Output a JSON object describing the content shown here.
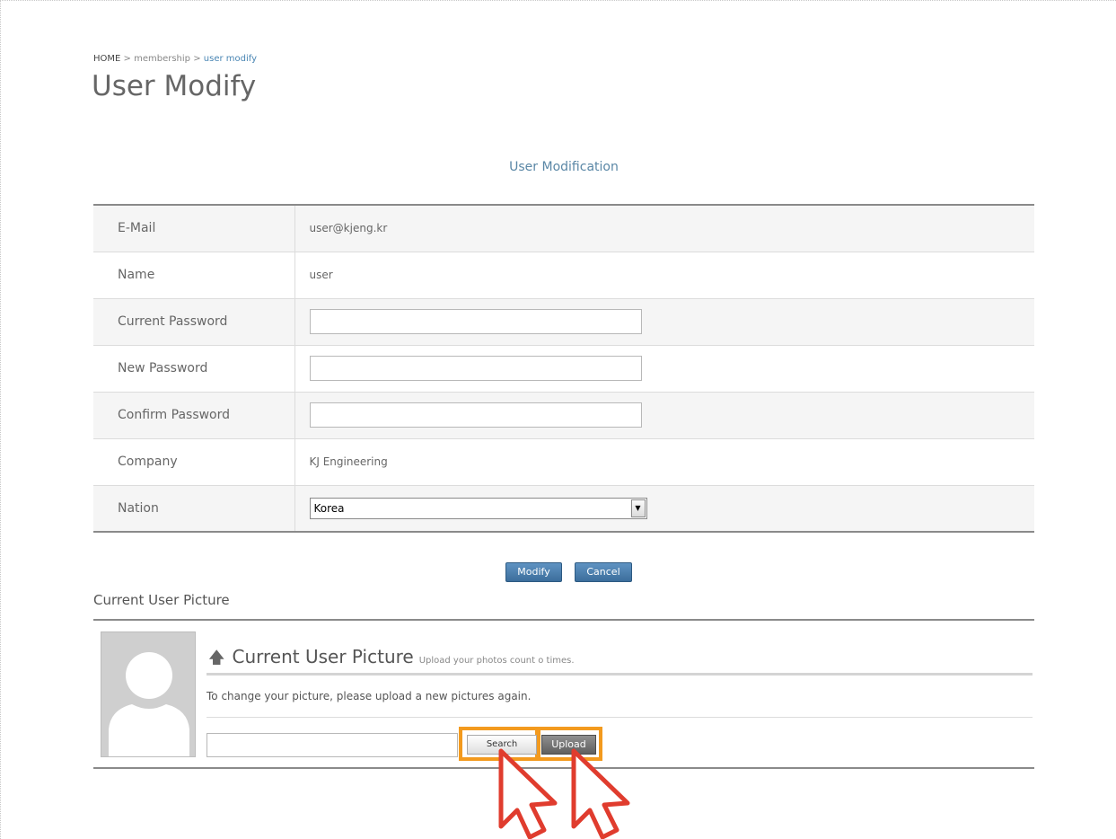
{
  "breadcrumb": {
    "home": "HOME",
    "separator": " > ",
    "membership": "membership",
    "current": "user modify"
  },
  "page_title": "User Modify",
  "section_title": "User Modification",
  "form": {
    "email_label": "E-Mail",
    "email_value": "user@kjeng.kr",
    "name_label": "Name",
    "name_value": "user",
    "current_password_label": "Current Password",
    "current_password_value": "",
    "new_password_label": "New Password",
    "new_password_value": "",
    "confirm_password_label": "Confirm Password",
    "confirm_password_value": "",
    "company_label": "Company",
    "company_value": "KJ Engineering",
    "nation_label": "Nation",
    "nation_value": "Korea"
  },
  "actions": {
    "modify_label": "Modify",
    "cancel_label": "Cancel"
  },
  "picture": {
    "heading": "Current User Picture",
    "panel_title": "Current User Picture",
    "panel_subtitle": "Upload your photos count o times.",
    "description": "To change your picture, please upload a new pictures again.",
    "file_value": "",
    "search_label": "Search",
    "upload_label": "Upload"
  },
  "icons": {
    "upload_arrow": "upload-arrow-icon",
    "select_arrow": "chevron-down-icon",
    "avatar": "default-avatar-icon",
    "cursor": "pointer-cursor-icon"
  },
  "colors": {
    "highlight": "#f39a1e",
    "cursor": "#e03c2e",
    "button_blue": "#4a7fae",
    "link_blue": "#4a86b4"
  }
}
